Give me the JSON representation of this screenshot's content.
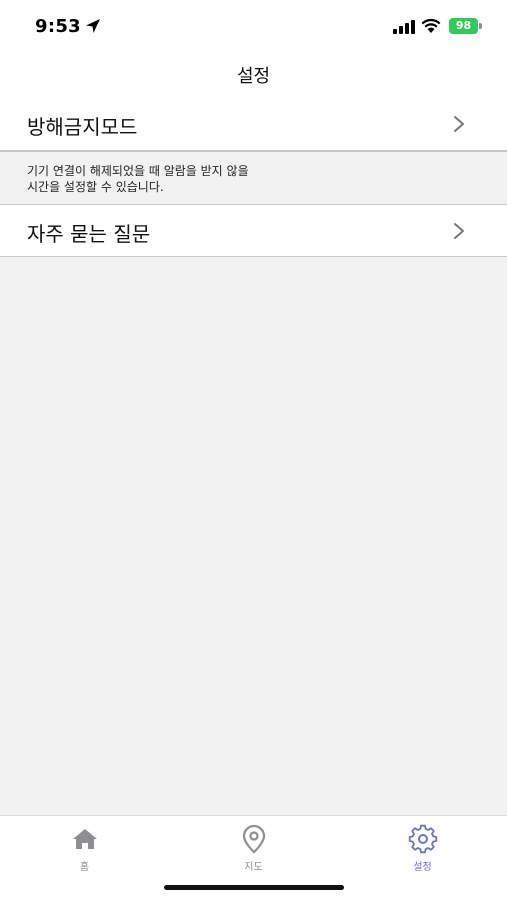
{
  "status_bar": {
    "time": "9:53",
    "battery_level": "98",
    "icons": [
      "location-arrow-icon",
      "cellular-signal-icon",
      "wifi-icon",
      "battery-charging-icon"
    ]
  },
  "nav": {
    "title": "설정"
  },
  "settings": {
    "do_not_disturb": {
      "label": "방해금지모드",
      "description_line1": "기기 연결이 해제되었을 때 알람을 받지 않을",
      "description_line2": "시간을 설정할 수 있습니다."
    },
    "faq": {
      "label": "자주 묻는 질문"
    }
  },
  "tab_bar": {
    "tabs": [
      {
        "label": "홈",
        "icon": "home-icon",
        "active": false
      },
      {
        "label": "지도",
        "icon": "map-pin-icon",
        "active": false
      },
      {
        "label": "설정",
        "icon": "gear-icon",
        "active": true
      }
    ],
    "active_color": "#6a74c9",
    "inactive_color": "#8e8e93"
  },
  "colors": {
    "battery": "#34c759",
    "background": "#f2f2f2",
    "surface": "#ffffff"
  }
}
